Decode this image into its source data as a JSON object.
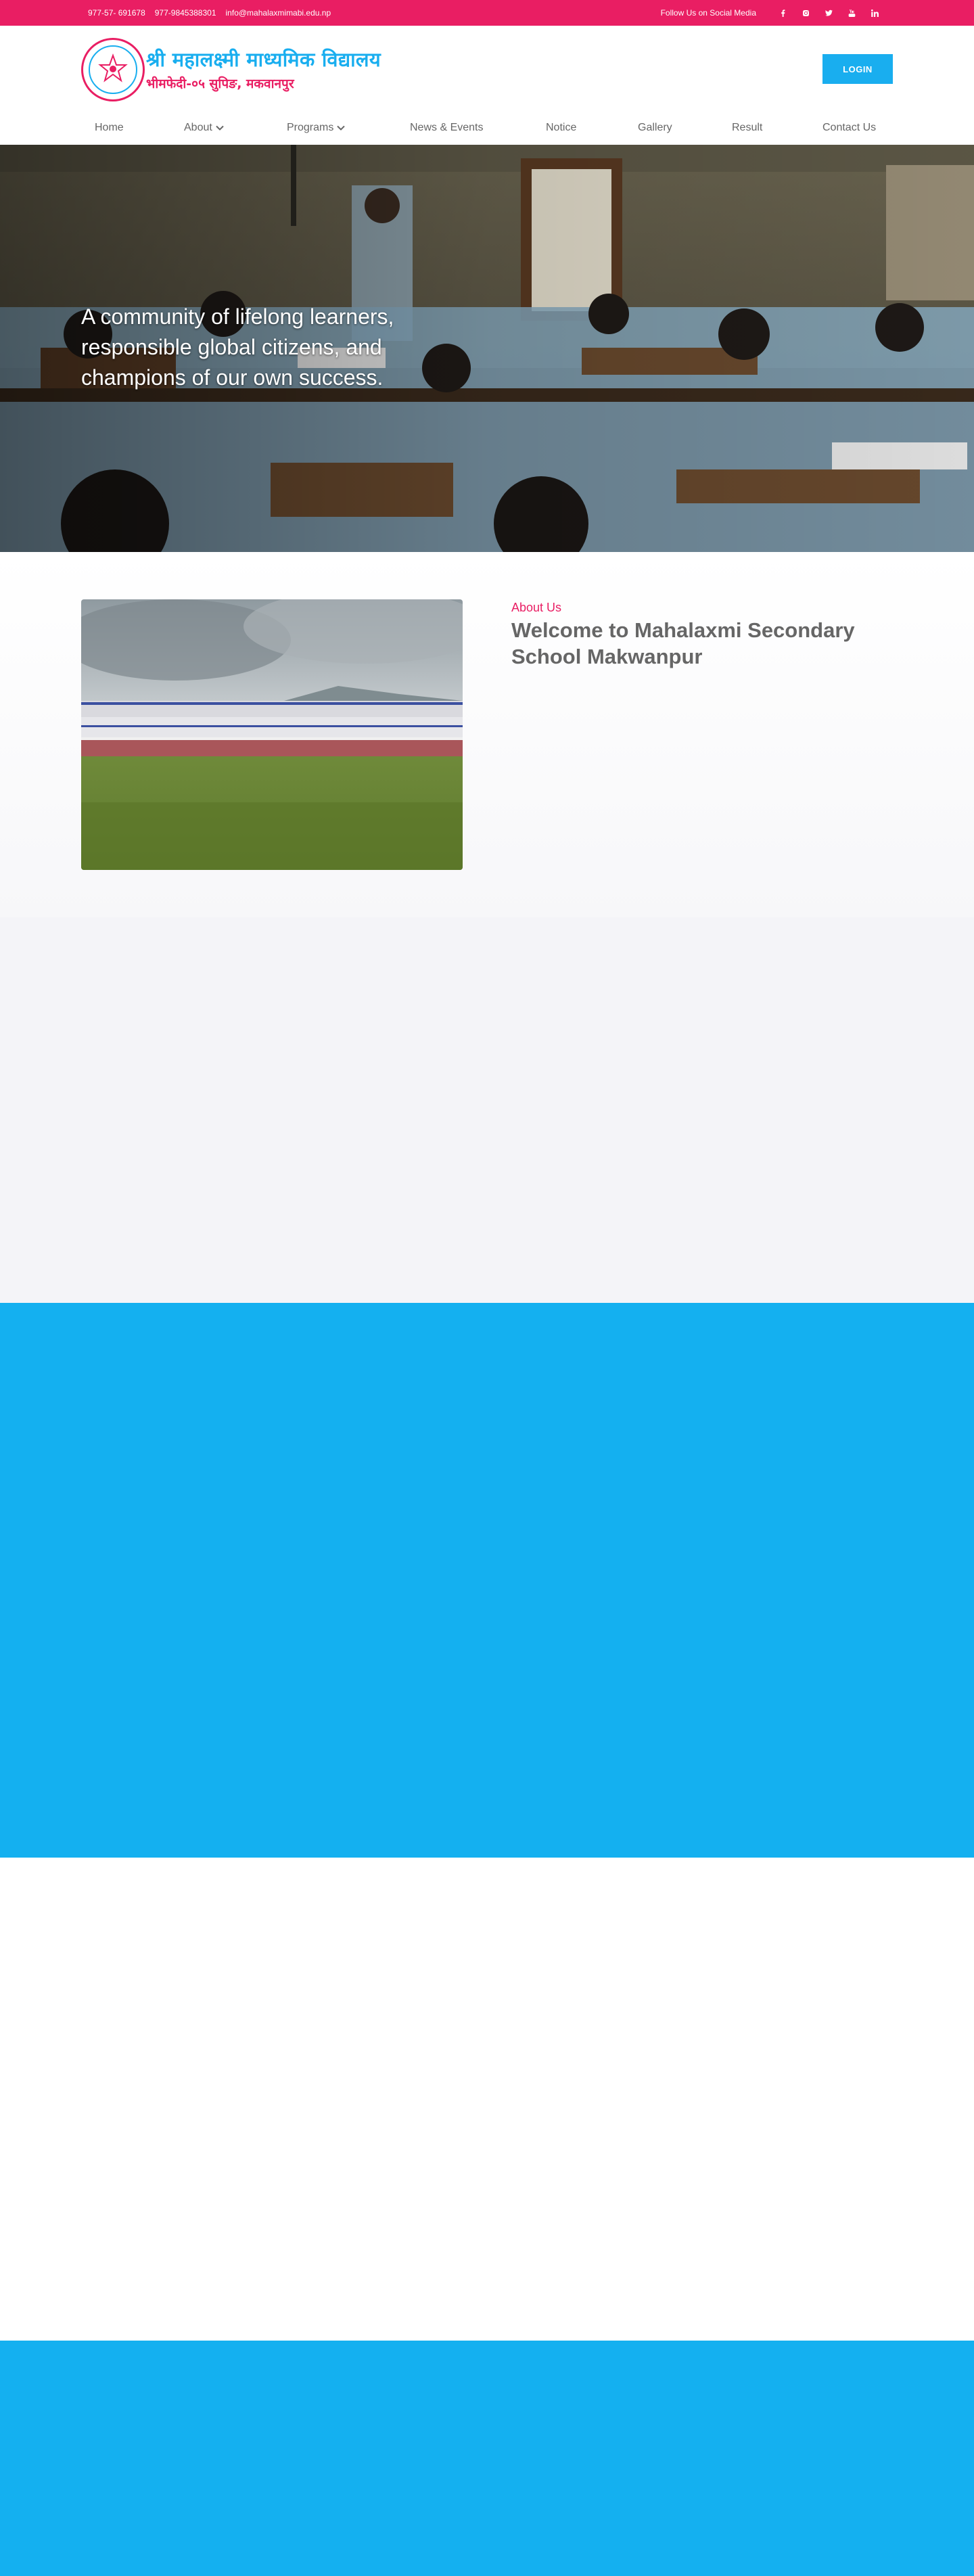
{
  "topbar": {
    "phone1": "977-57- 691678",
    "phone2": "977-9845388301",
    "email": "info@mahalaxmimabi.edu.np",
    "follow_label": "Follow Us on Social Media",
    "social_icons": [
      "facebook-icon",
      "instagram-icon",
      "twitter-icon",
      "youtube-icon",
      "linkedin-icon"
    ]
  },
  "header": {
    "title": "श्री महालक्ष्मी माध्यमिक विद्यालय",
    "subtitle": "भीमफेदी-०५ सुपिङ, मकवानपुर",
    "login_label": "LOGIN"
  },
  "nav": {
    "items": [
      {
        "label": "Home",
        "dropdown": false
      },
      {
        "label": "About",
        "dropdown": true
      },
      {
        "label": "Programs",
        "dropdown": true
      },
      {
        "label": "News & Events",
        "dropdown": false
      },
      {
        "label": "Notice",
        "dropdown": false
      },
      {
        "label": "Gallery",
        "dropdown": false
      },
      {
        "label": "Result",
        "dropdown": false
      },
      {
        "label": "Contact Us",
        "dropdown": false
      }
    ]
  },
  "hero": {
    "tagline": "A community of lifelong learners, responsible global citizens, and champions of our own success."
  },
  "about": {
    "eyebrow": "About Us",
    "title": "Welcome to Mahalaxmi Secondary School Makwanpur"
  },
  "colors": {
    "accent_pink": "#e91e63",
    "accent_blue": "#19aeef",
    "section_blue": "#14b0f0",
    "section_grey": "#f4f4f8"
  }
}
